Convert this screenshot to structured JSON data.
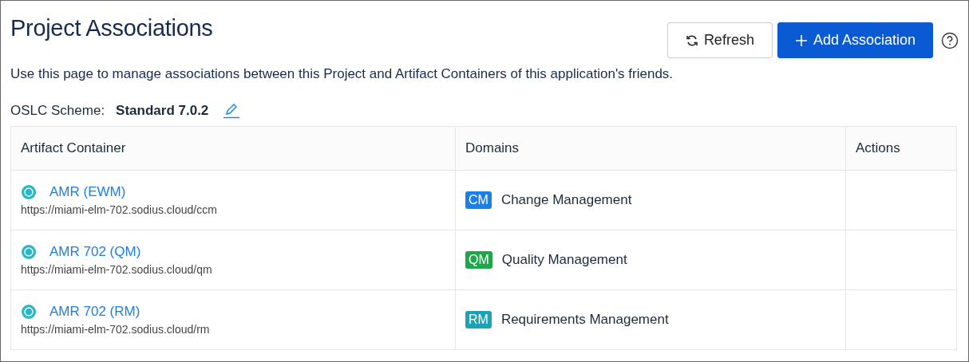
{
  "title": "Project Associations",
  "buttons": {
    "refresh": "Refresh",
    "add": "Add Association"
  },
  "description": "Use this page to manage associations between this Project and Artifact Containers of this application's friends.",
  "scheme": {
    "label": "OSLC Scheme:",
    "value": "Standard 7.0.2"
  },
  "table": {
    "columns": [
      "Artifact Container",
      "Domains",
      "Actions"
    ],
    "rows": [
      {
        "name": "AMR (EWM)",
        "url": "https://miami-elm-702.sodius.cloud/ccm",
        "badge": "CM",
        "color": "#1a7fe8",
        "domain": "Change Management"
      },
      {
        "name": "AMR 702 (QM)",
        "url": "https://miami-elm-702.sodius.cloud/qm",
        "badge": "QM",
        "color": "#1ea64b",
        "domain": "Quality Management"
      },
      {
        "name": "AMR 702 (RM)",
        "url": "https://miami-elm-702.sodius.cloud/rm",
        "badge": "RM",
        "color": "#19a3b5",
        "domain": "Requirements Management"
      }
    ]
  }
}
